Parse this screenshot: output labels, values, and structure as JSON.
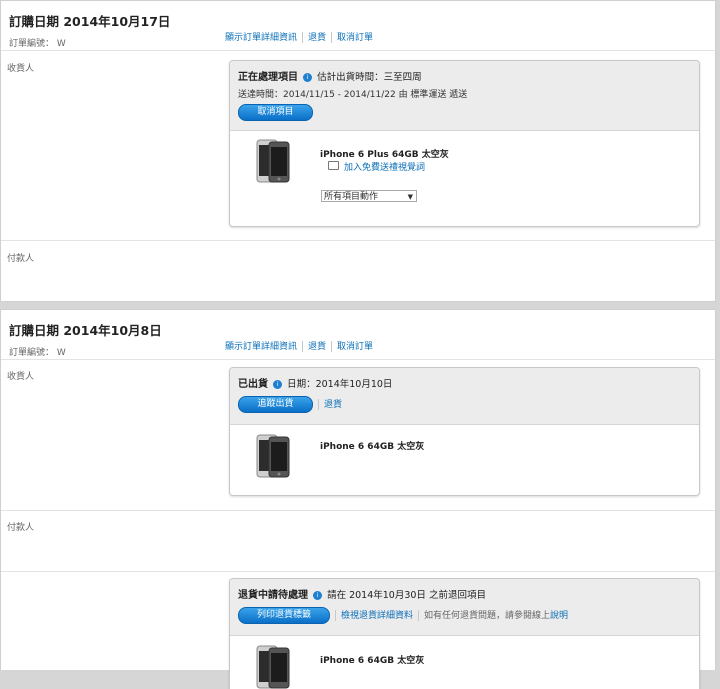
{
  "orders": [
    {
      "header_title": "訂購日期 2014年10月17日",
      "order_no_label": "訂單編號：",
      "order_no_value": "W",
      "links": {
        "details": "顯示訂單詳細資訊",
        "return": "退貨",
        "cancel": "取消訂單"
      },
      "recipient_label": "收貨人",
      "payer_label": "付款人",
      "shipment": {
        "status": "正在處理項目",
        "status_info": "估計出貨時間：三至四周",
        "delivery": "送達時間：2014/11/15 - 2014/11/22 由 標準運送 遞送",
        "button": "取消項目",
        "item_name": "iPhone 6 Plus 64GB 太空灰",
        "gift_link": "加入免費送禮視覺詞",
        "select_value": "所有項目動作"
      }
    },
    {
      "header_title": "訂購日期 2014年10月8日",
      "order_no_label": "訂單編號：",
      "order_no_value": "W",
      "links": {
        "details": "顯示訂單詳細資訊",
        "return": "退貨",
        "cancel": "取消訂單"
      },
      "recipient_label": "收貨人",
      "payer_label": "付款人",
      "shipment": {
        "status": "已出貨",
        "status_info": "日期：2014年10月10日",
        "button": "追蹤出貨",
        "link": "退貨",
        "item_name": "iPhone 6 64GB 太空灰"
      },
      "return_shipment": {
        "status": "退貨中請待處理",
        "status_info": "請在 2014年10月30日 之前退回項目",
        "button": "列印退貨標籤",
        "link": "檢視退貨詳細資料",
        "help_prefix": "如有任何退貨問題，請參閱線上",
        "help_link": "說明",
        "item_name": "iPhone 6 64GB 太空灰"
      }
    }
  ]
}
